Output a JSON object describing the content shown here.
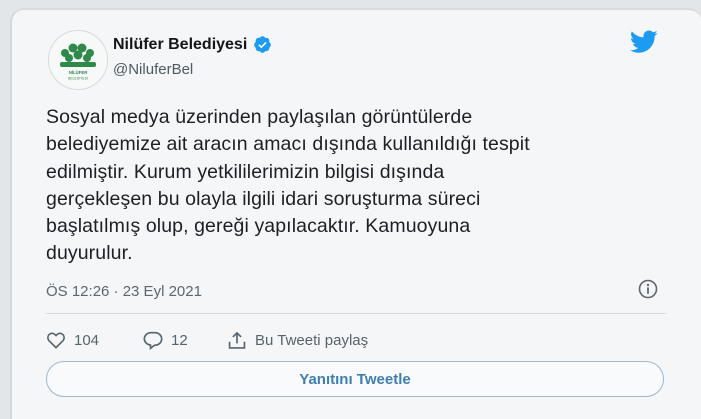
{
  "tweet": {
    "author": {
      "display_name": "Nilüfer Belediyesi",
      "handle": "@NiluferBel",
      "verified": true,
      "avatar_icon": "nilufer-municipality-logo",
      "logo_text": "NİLÜFER BELEDİYESİ"
    },
    "text_lines": [
      "Sosyal medya üzerinden paylaşılan görüntülerde",
      "belediyemize ait aracın amacı dışında kullanıldığı tespit",
      "edilmiştir. Kurum yetkililerimizin bilgisi dışında",
      "gerçekleşen bu olayla ilgili idari soruşturma süreci",
      "başlatılmış olup, gereği yapılacaktır. Kamuoyuna",
      "duyurulur."
    ],
    "timestamp": "ÖS 12:26 · 23 Eyl 2021",
    "actions": {
      "like_count": "104",
      "reply_count": "12",
      "share_label": "Bu Tweeti paylaş"
    },
    "reply_button_label": "Yanıtını Tweetle"
  },
  "colors": {
    "accent": "#1d9bf0",
    "reply_text": "#3f7fb0",
    "logo_green": "#2f8a4a"
  }
}
